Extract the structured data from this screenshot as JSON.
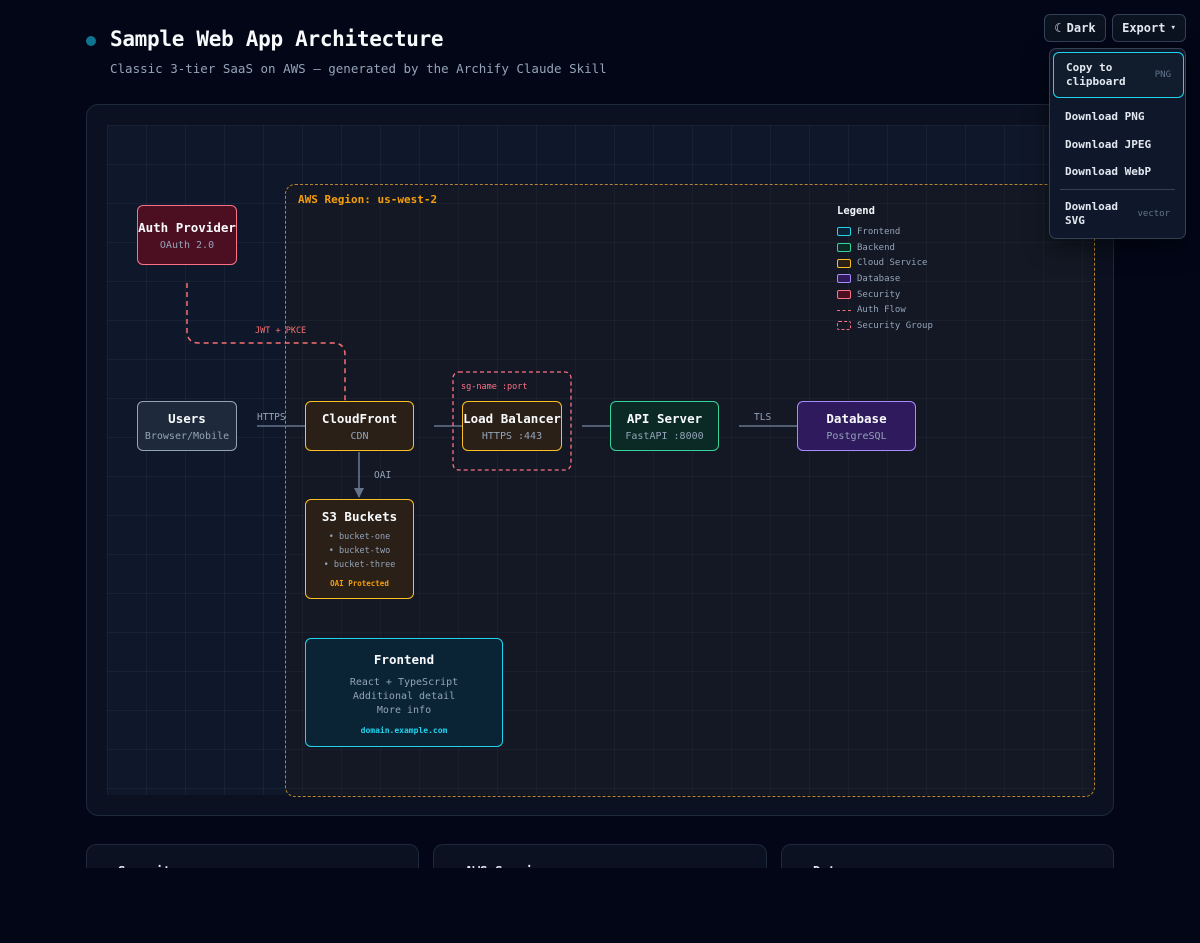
{
  "header": {
    "title": "Sample Web App Architecture",
    "subtitle": "Classic 3-tier SaaS on AWS — generated by the Archify Claude Skill"
  },
  "toolbar": {
    "dark_label": "Dark",
    "dark_icon": "moon-icon",
    "export_label": "Export",
    "export_icon": "chevron-down-icon"
  },
  "export_menu": {
    "copy_label": "Copy to clipboard",
    "copy_hint": "PNG",
    "png_label": "Download PNG",
    "jpeg_label": "Download JPEG",
    "webp_label": "Download WebP",
    "svg_label": "Download SVG",
    "svg_hint": "vector"
  },
  "diagram": {
    "region_label": "AWS Region: us-west-2",
    "nodes": {
      "auth": {
        "title": "Auth Provider",
        "subtitle": "OAuth 2.0"
      },
      "users": {
        "title": "Users",
        "subtitle": "Browser/Mobile"
      },
      "cloudfront": {
        "title": "CloudFront",
        "subtitle": "CDN"
      },
      "lb": {
        "title": "Load Balancer",
        "subtitle": "HTTPS :443"
      },
      "api": {
        "title": "API Server",
        "subtitle": "FastAPI :8000"
      },
      "db": {
        "title": "Database",
        "subtitle": "PostgreSQL"
      },
      "s3": {
        "title": "S3 Buckets",
        "items": [
          "• bucket-one",
          "• bucket-two",
          "• bucket-three"
        ],
        "badge": "OAI Protected"
      },
      "frontend": {
        "title": "Frontend",
        "lines": [
          "React + TypeScript",
          "Additional detail",
          "More info"
        ],
        "domain": "domain.example.com"
      }
    },
    "security_group_label": "sg-name :port",
    "edges": {
      "auth_flow": "JWT + PKCE",
      "users_cf": "HTTPS",
      "cf_s3": "OAI",
      "api_db": "TLS"
    },
    "legend": {
      "title": "Legend",
      "items": [
        "Frontend",
        "Backend",
        "Cloud Service",
        "Database",
        "Security",
        "Auth Flow",
        "Security Group"
      ]
    },
    "colors": {
      "frontend": "#22d3ee",
      "backend": "#34d399",
      "cloud_service": "#fbbf24",
      "database": "#a78bfa",
      "security": "#fb7185",
      "region": "#f59e0b"
    }
  },
  "bottom_cards": [
    {
      "label": "Security",
      "color": "#f43f5e"
    },
    {
      "label": "AWS Services",
      "color": "#f59e0b"
    },
    {
      "label": "Data",
      "color": "#8b5cf6"
    }
  ]
}
